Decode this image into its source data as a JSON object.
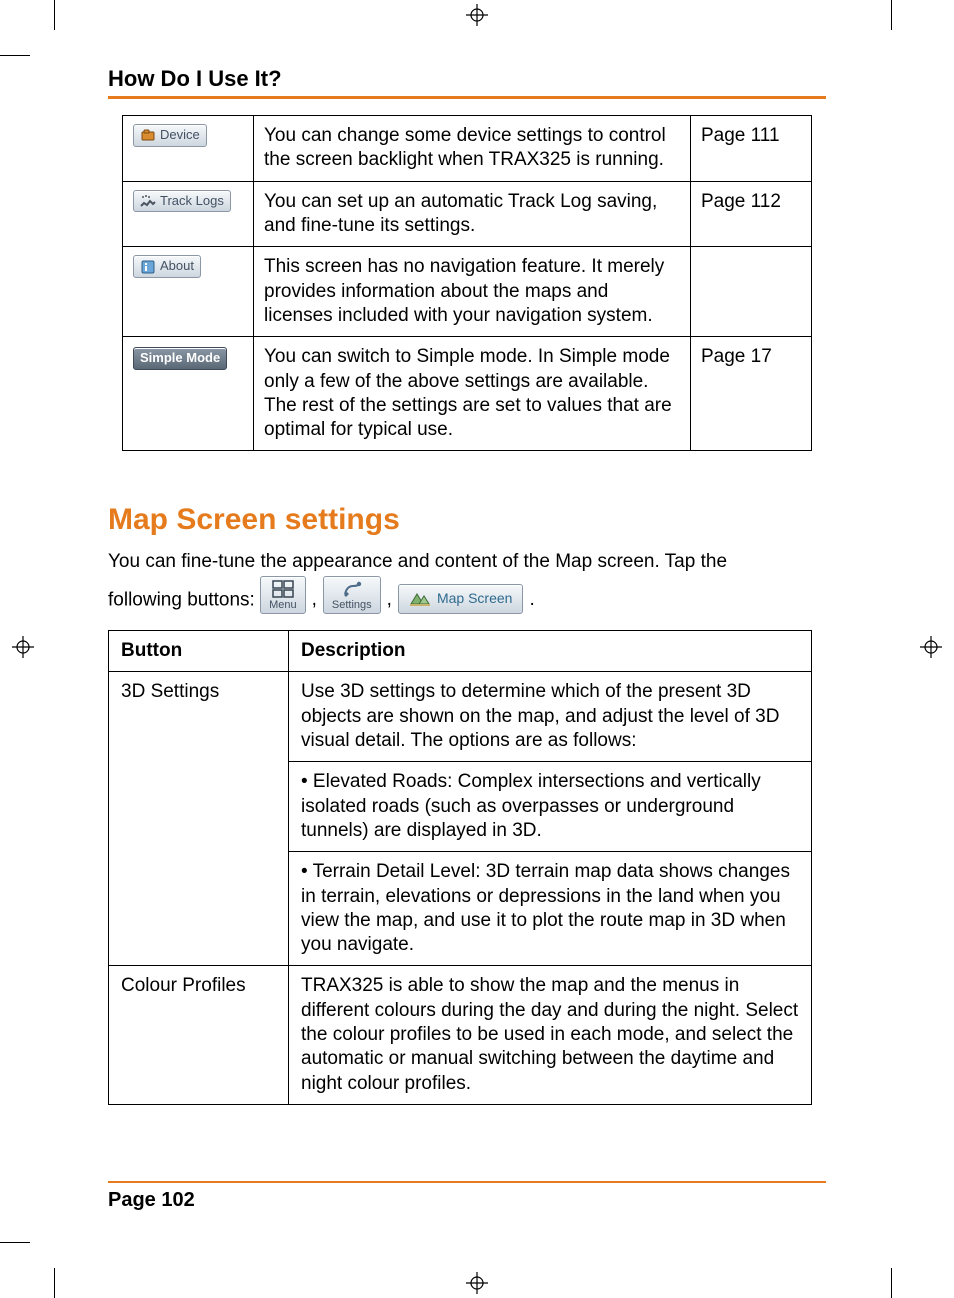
{
  "header": {
    "title": "How Do I Use It?"
  },
  "table1": {
    "rows": [
      {
        "icon_label": "Device",
        "desc": "You can change some device settings to control the screen backlight when TRAX325 is running.",
        "page": "Page 111"
      },
      {
        "icon_label": "Track Logs",
        "desc": "You can set up an automatic Track Log saving, and fine-tune its settings.",
        "page": "Page 112"
      },
      {
        "icon_label": "About",
        "desc": "This screen has no navigation feature. It merely provides information about the maps and licenses included with your navigation system.",
        "page": ""
      },
      {
        "icon_label": "Simple Mode",
        "desc": "You can switch to Simple mode. In Simple mode only a few of the above settings are available. The rest of the settings are set to values that are optimal for typical use.",
        "page": "Page 17"
      }
    ]
  },
  "section": {
    "title": "Map Screen settings",
    "intro_a": "You can fine-tune the appearance and content of the Map screen. Tap the",
    "intro_b": "following buttons:",
    "buttons": {
      "menu": "Menu",
      "settings": "Settings",
      "mapscreen": "Map Screen"
    },
    "sep1": ",",
    "sep2": ",",
    "end": "."
  },
  "table2": {
    "headers": {
      "button": "Button",
      "desc": "Description"
    },
    "rows": [
      {
        "button": "3D Settings",
        "desc_parts": [
          "Use 3D settings to determine which of the present 3D objects are shown on the map, and adjust the level of 3D visual detail. The options are as follows:",
          "• Elevated Roads: Complex intersections and vertically isolated roads (such as overpasses or underground tunnels) are displayed in 3D.",
          "• Terrain Detail Level: 3D terrain map data shows changes in terrain, elevations or depressions in the land when you view the map, and use it to plot the route map in 3D when you navigate."
        ]
      },
      {
        "button": "Colour Profiles",
        "desc_parts": [
          "TRAX325 is able to show the map and the menus in different colours during the day and during the night. Select the colour profiles to be used in each mode, and select the automatic or manual switching between the daytime and night colour profiles."
        ]
      }
    ]
  },
  "footer": {
    "page": "Page 102"
  }
}
